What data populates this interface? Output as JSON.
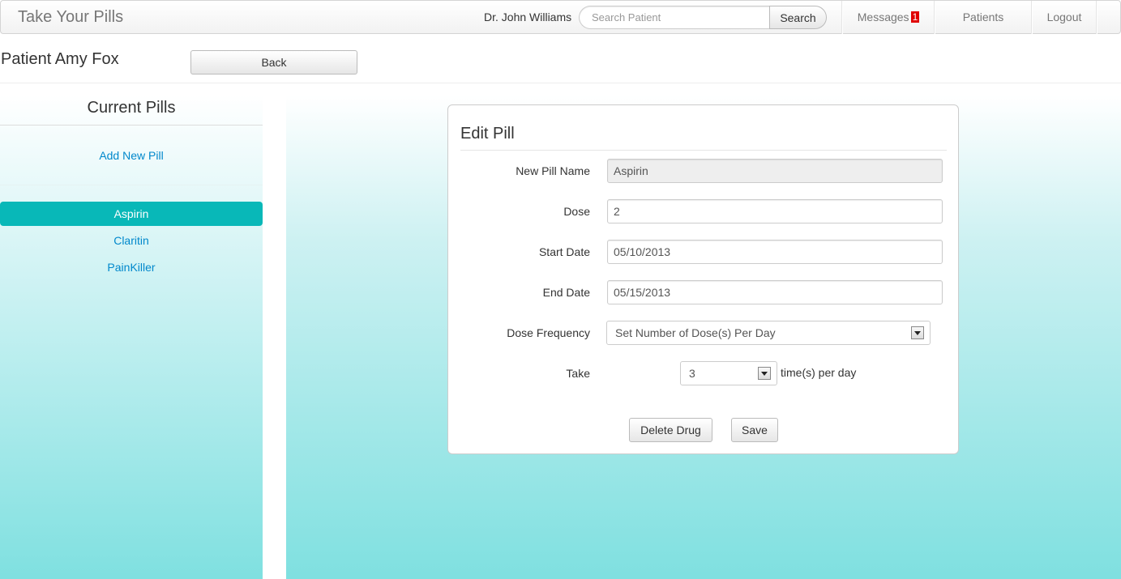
{
  "navbar": {
    "brand": "Take Your Pills",
    "doctor": "Dr. John Williams",
    "search_placeholder": "Search Patient",
    "search_button": "Search",
    "messages_label": "Messages",
    "messages_count": "1",
    "patients_label": "Patients",
    "logout_label": "Logout"
  },
  "patient": {
    "title": "Patient Amy Fox",
    "back_button": "Back"
  },
  "sidebar": {
    "title": "Current Pills",
    "add_link": "Add New Pill",
    "pills": [
      {
        "label": "Aspirin",
        "active": true
      },
      {
        "label": "Claritin",
        "active": false
      },
      {
        "label": "PainKiller",
        "active": false
      }
    ]
  },
  "form": {
    "title": "Edit Pill",
    "name_label": "New Pill Name",
    "name_value": "Aspirin",
    "dose_label": "Dose",
    "dose_value": "2",
    "start_label": "Start Date",
    "start_value": "05/10/2013",
    "end_label": "End Date",
    "end_value": "05/15/2013",
    "frequency_label": "Dose Frequency",
    "frequency_value": "Set Number of Dose(s) Per Day",
    "take_label": "Take",
    "take_value": "3",
    "take_suffix": "time(s) per day",
    "delete_button": "Delete Drug",
    "save_button": "Save"
  },
  "colors": {
    "accent": "#08b8b8",
    "link": "#0088cc",
    "badge": "#e00000"
  }
}
